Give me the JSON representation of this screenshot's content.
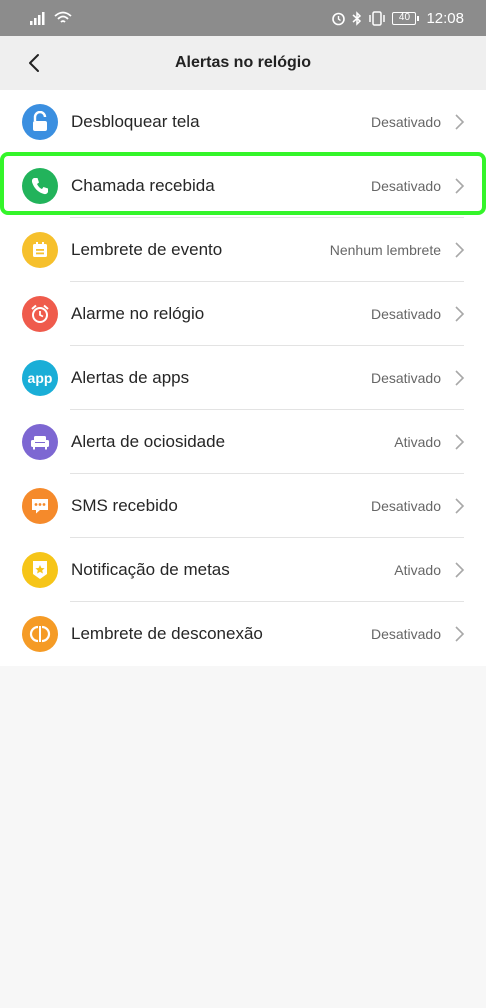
{
  "status_bar": {
    "time": "12:08",
    "battery": "40",
    "icons": [
      "signal-icon",
      "wifi-icon",
      "alarm-icon",
      "bluetooth-icon",
      "vibrate-icon",
      "battery-icon"
    ]
  },
  "header": {
    "title": "Alertas no relógio",
    "back_icon": "chevron-left-icon"
  },
  "items": [
    {
      "label": "Desbloquear tela",
      "value": "Desativado",
      "icon": "unlock-icon",
      "color": "#3b8fe0"
    },
    {
      "label": "Chamada recebida",
      "value": "Desativado",
      "icon": "phone-icon",
      "color": "#22b35b"
    },
    {
      "label": "Lembrete de evento",
      "value": "Nenhum lembrete",
      "icon": "calendar-icon",
      "color": "#f6c02c"
    },
    {
      "label": "Alarme no relógio",
      "value": "Desativado",
      "icon": "alarm-clock-icon",
      "color": "#ef5b4c"
    },
    {
      "label": "Alertas de apps",
      "value": "Desativado",
      "icon": "app-icon",
      "icon_text": "app",
      "color": "#1aaed7"
    },
    {
      "label": "Alerta de ociosidade",
      "value": "Ativado",
      "icon": "sofa-icon",
      "color": "#7d67d2"
    },
    {
      "label": "SMS recebido",
      "value": "Desativado",
      "icon": "message-icon",
      "color": "#f58a2b"
    },
    {
      "label": "Notificação de metas",
      "value": "Ativado",
      "icon": "goal-badge-icon",
      "color": "#f6c518"
    },
    {
      "label": "Lembrete de desconexão",
      "value": "Desativado",
      "icon": "disconnect-icon",
      "color": "#f59b26"
    }
  ],
  "highlight_color": "#34f52a"
}
